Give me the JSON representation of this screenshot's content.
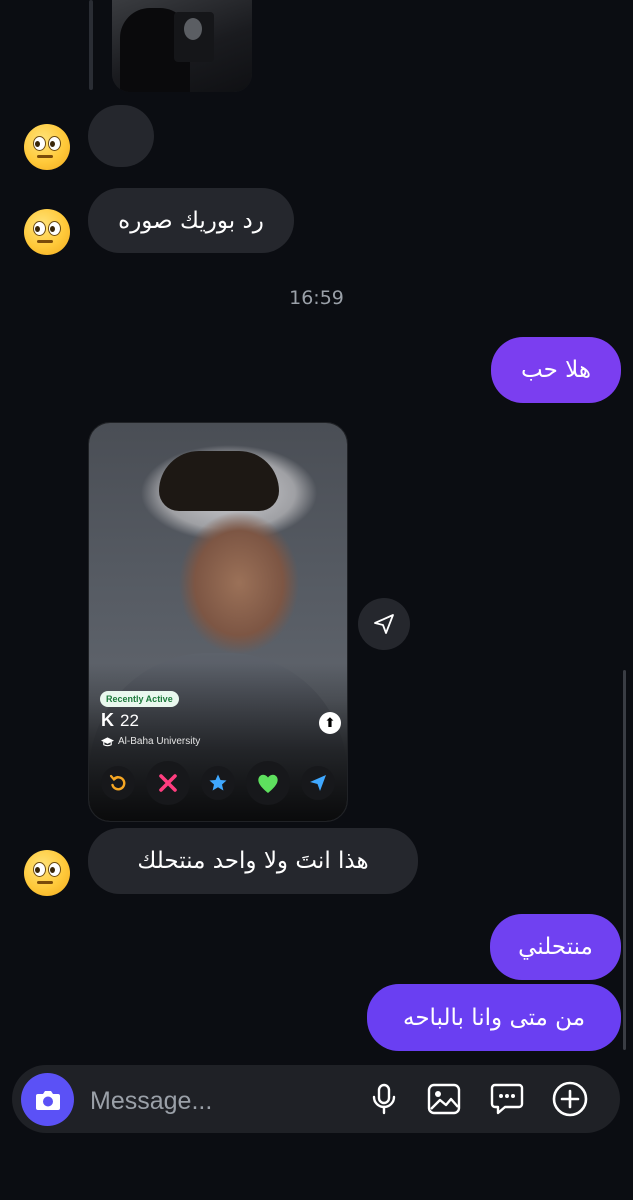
{
  "colors": {
    "background": "#0b0d12",
    "incoming_bubble": "#25272d",
    "outgoing_bubble": "#7b3ef0",
    "outgoing_bubble_alt": "#6a3ff2",
    "camera_button": "#5b51f6"
  },
  "messages": {
    "incoming_1": "رد بوريك صوره",
    "timestamp": "16:59",
    "outgoing_1": "هلا حب",
    "incoming_2": "هذا انتَ ولا واحد منتحلك",
    "outgoing_2": "منتحلني",
    "outgoing_3": "من متى وانا بالباحه"
  },
  "profile_card": {
    "badge": "Recently Active",
    "name": "K",
    "age": "22",
    "school": "Al-Baha University",
    "actions": [
      "rewind-icon",
      "nope-icon",
      "super-like-icon",
      "like-icon",
      "boost-icon"
    ]
  },
  "composer": {
    "placeholder": "Message...",
    "icons": [
      "camera-icon",
      "microphone-icon",
      "gallery-icon",
      "sticker-icon",
      "add-icon"
    ]
  }
}
